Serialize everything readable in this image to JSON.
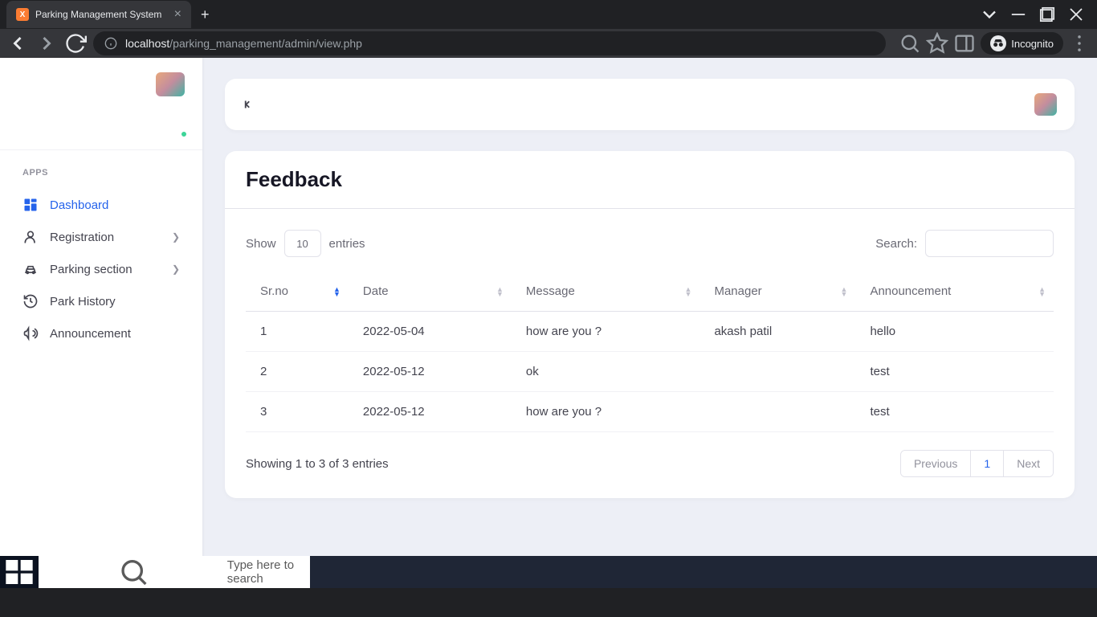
{
  "browser": {
    "tab_title": "Parking Management System",
    "url_host": "localhost",
    "url_path": "/parking_management/admin/view.php",
    "incognito_label": "Incognito"
  },
  "sidebar": {
    "section_label": "APPS",
    "items": [
      {
        "label": "Dashboard",
        "icon": "dashboard",
        "active": true
      },
      {
        "label": "Registration",
        "icon": "person",
        "expandable": true
      },
      {
        "label": "Parking section",
        "icon": "car",
        "expandable": true
      },
      {
        "label": "Park History",
        "icon": "history"
      },
      {
        "label": "Announcement",
        "icon": "bullhorn"
      }
    ]
  },
  "page": {
    "title": "Feedback",
    "show_label": "Show",
    "entries_label": "entries",
    "entries_value": "10",
    "search_label": "Search:",
    "columns": [
      "Sr.no",
      "Date",
      "Message",
      "Manager",
      "Announcement"
    ],
    "rows": [
      {
        "srno": "1",
        "date": "2022-05-04",
        "message": "how are you ?",
        "manager": "akash patil",
        "announcement": "hello"
      },
      {
        "srno": "2",
        "date": "2022-05-12",
        "message": "ok",
        "manager": "",
        "announcement": "test"
      },
      {
        "srno": "3",
        "date": "2022-05-12",
        "message": "how are you ?",
        "manager": "",
        "announcement": "test"
      }
    ],
    "info_text": "Showing 1 to 3 of 3 entries",
    "prev_label": "Previous",
    "next_label": "Next",
    "current_page": "1"
  },
  "taskbar": {
    "search_placeholder": "Type here to search"
  }
}
